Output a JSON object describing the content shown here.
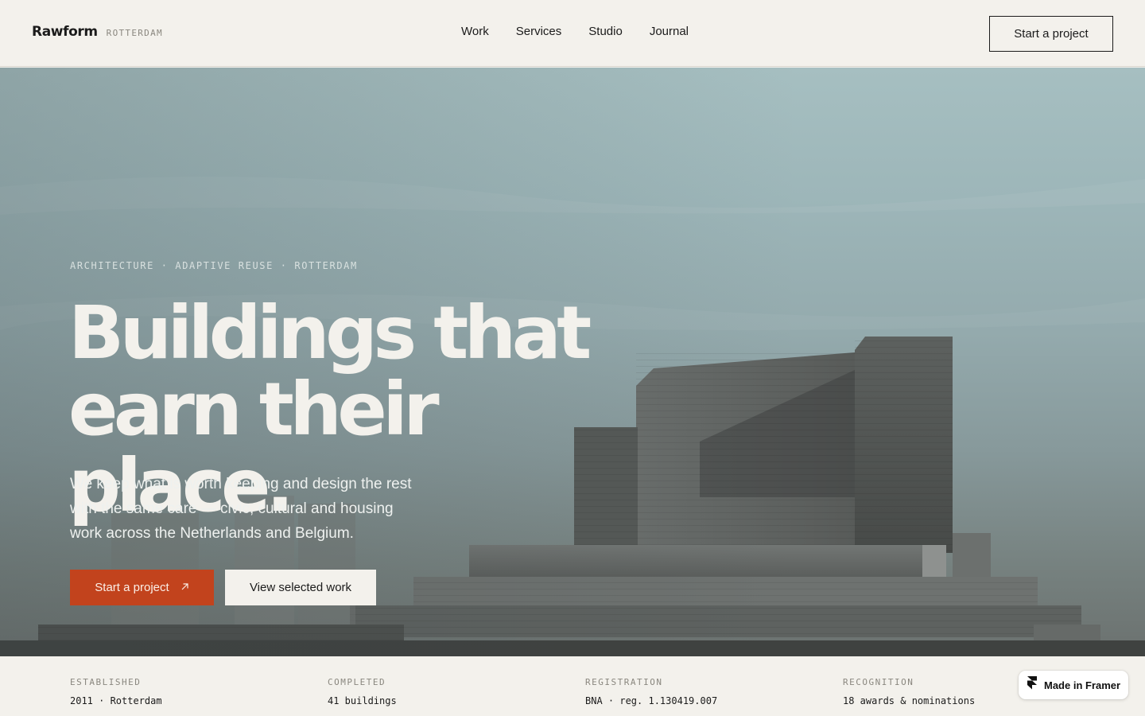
{
  "header": {
    "brand_name": "Rawform",
    "brand_city": "ROTTERDAM",
    "nav": [
      "Work",
      "Services",
      "Studio",
      "Journal"
    ],
    "cta_label": "Start a project"
  },
  "hero": {
    "eyebrow": "ARCHITECTURE · ADAPTIVE REUSE · ROTTERDAM",
    "headline_line1": "Buildings that",
    "headline_line2": "earn their place.",
    "lede": "We keep what is worth keeping and design the rest with the same care — civic, cultural and housing work across the Netherlands and Belgium.",
    "primary_cta": "Start a project",
    "secondary_cta": "View selected work"
  },
  "facts": [
    {
      "label": "ESTABLISHED",
      "value": "2011 · Rotterdam"
    },
    {
      "label": "COMPLETED",
      "value": "41 buildings"
    },
    {
      "label": "REGISTRATION",
      "value": "BNA · reg. 1.130419.007"
    },
    {
      "label": "RECOGNITION",
      "value": "18 awards & nominations"
    }
  ],
  "badge": {
    "label": "Made in Framer"
  },
  "colors": {
    "background": "#f3f1ec",
    "accent": "#c2431d",
    "text": "#1b1b1b",
    "muted": "#8a877f"
  },
  "icons": {
    "primary_cta_icon": "arrow-up-right-icon",
    "badge_icon": "framer-logo-icon"
  }
}
